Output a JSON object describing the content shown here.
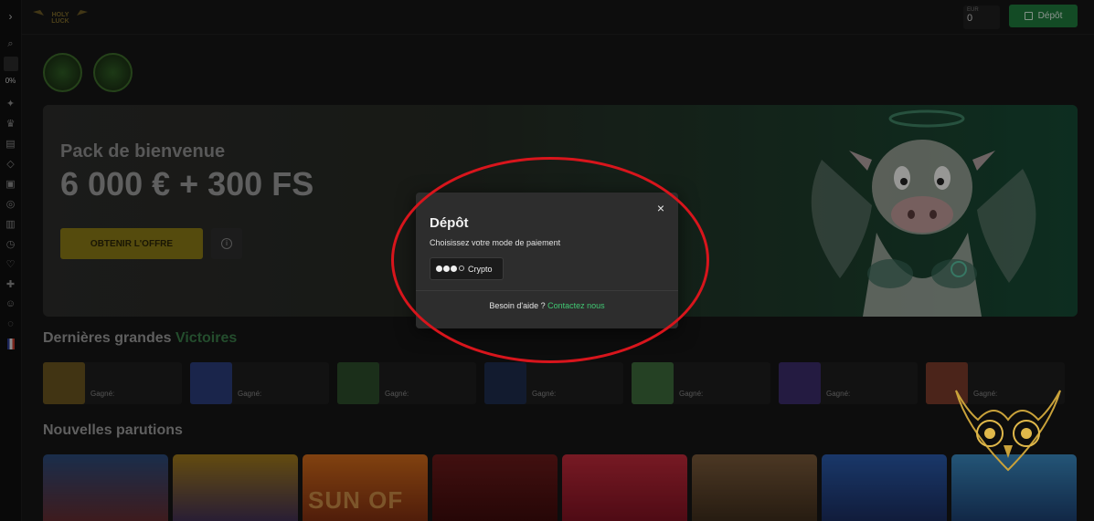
{
  "topbar": {
    "balance_label": "EUR",
    "balance_value": "0",
    "deposit_label": "Dépôt",
    "brand_logo_text": "HOLY LUCK"
  },
  "sidebar": {
    "percent": "0%"
  },
  "banner": {
    "subtitle": "Pack de bienvenue",
    "title": "6 000 € + 300 FS",
    "cta_label": "OBTENIR L'OFFRE"
  },
  "sections": {
    "wins_title": "Dernières grandes",
    "wins_accent": "Victoires",
    "new_title": "Nouvelles parutions"
  },
  "wins": [
    {
      "label": "Gagné:",
      "thumb": "#6a5520"
    },
    {
      "label": "Gagné:",
      "thumb": "#2a3d7a"
    },
    {
      "label": "Gagné:",
      "thumb": "#2d4d2a"
    },
    {
      "label": "Gagné:",
      "thumb": "#1d2d4d"
    },
    {
      "label": "Gagné:",
      "thumb": "#3d6a3a"
    },
    {
      "label": "Gagné:",
      "thumb": "#3a2d6a"
    },
    {
      "label": "Gagné:",
      "thumb": "#7a3a2a"
    }
  ],
  "games": [
    {
      "bg": "linear-gradient(180deg,#2a4a7a,#6a2a2a)",
      "text": ""
    },
    {
      "bg": "linear-gradient(180deg,#a07a1a,#3a2a5a)",
      "text": ""
    },
    {
      "bg": "linear-gradient(180deg,#d06a1a,#7a2a10)",
      "text": "SUN OF"
    },
    {
      "bg": "linear-gradient(180deg,#6a1a1a,#3a0a0a)",
      "text": ""
    },
    {
      "bg": "linear-gradient(180deg,#c02a3a,#7a1020)",
      "text": ""
    },
    {
      "bg": "linear-gradient(180deg,#7a5a3a,#3a2a1a)",
      "text": ""
    },
    {
      "bg": "linear-gradient(180deg,#2a5aaa,#1a2a5a)",
      "text": ""
    },
    {
      "bg": "linear-gradient(180deg,#3a8ac0,#1a3a6a)",
      "text": ""
    }
  ],
  "modal": {
    "title": "Dépôt",
    "subtitle": "Choisissez votre mode de paiement",
    "payment_option": "Crypto",
    "help_text": "Besoin d'aide ?",
    "help_link": "Contactez nous",
    "close_symbol": "×"
  },
  "colors": {
    "accent_green": "#41c873",
    "deposit_green": "#1f7a3c",
    "annotation_red": "#d8151c",
    "offer_yellow": "#8a7a16"
  }
}
